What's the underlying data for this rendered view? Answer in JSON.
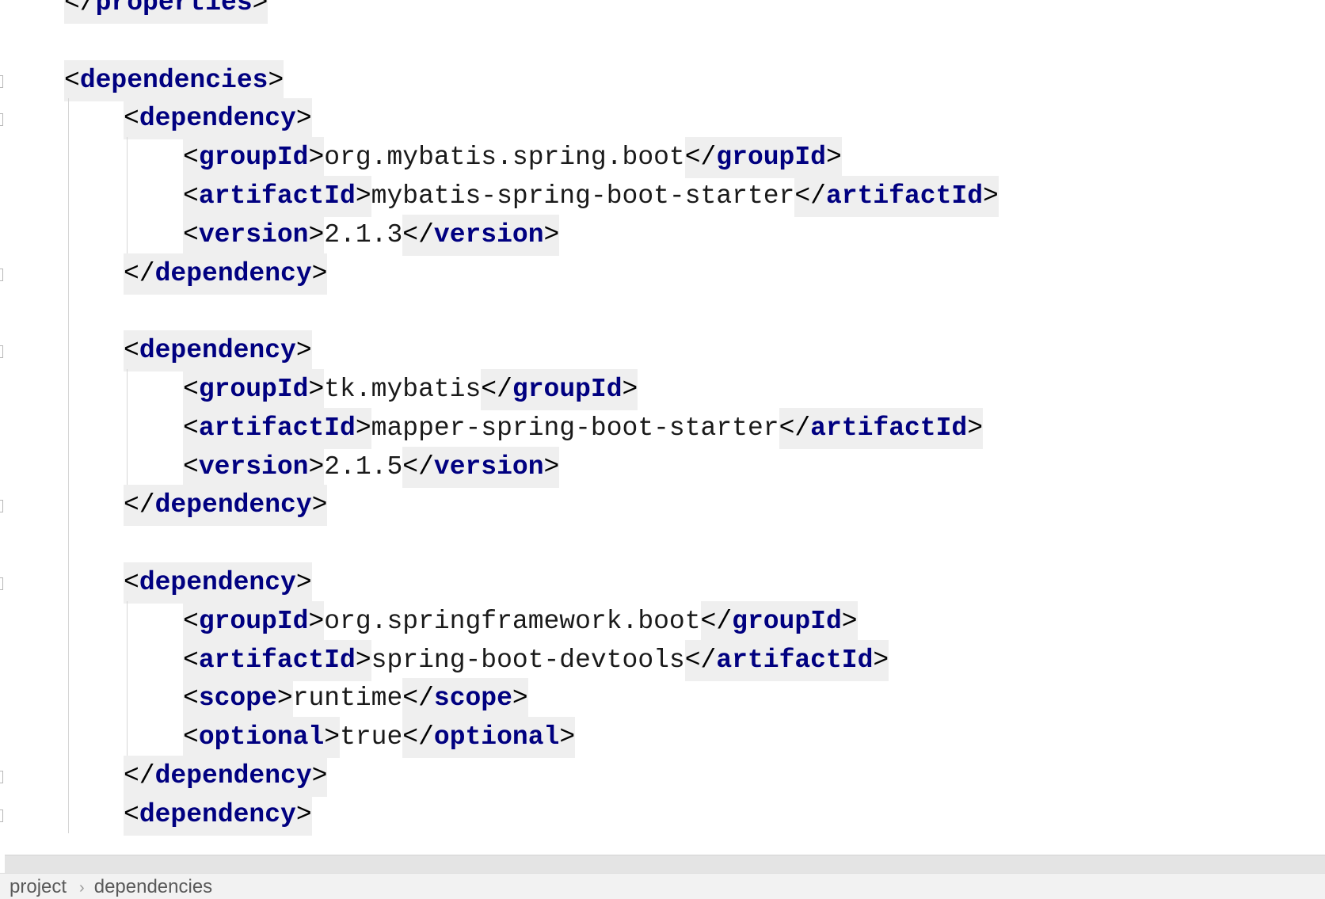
{
  "editor": {
    "lines": [
      {
        "indent": 0,
        "tokens": [
          {
            "t": "</"
          },
          {
            "tag": "properties"
          },
          {
            "t": ">"
          }
        ]
      },
      {
        "indent": 0,
        "tokens": []
      },
      {
        "indent": 0,
        "tokens": [
          {
            "t": "<"
          },
          {
            "tag": "dependencies"
          },
          {
            "t": ">"
          }
        ]
      },
      {
        "indent": 1,
        "tokens": [
          {
            "t": "<"
          },
          {
            "tag": "dependency"
          },
          {
            "t": ">"
          }
        ]
      },
      {
        "indent": 2,
        "tokens": [
          {
            "t": "<"
          },
          {
            "tag": "groupId"
          },
          {
            "t": ">"
          },
          {
            "text": "org.mybatis.spring.boot"
          },
          {
            "t": "</"
          },
          {
            "tag": "groupId"
          },
          {
            "t": ">"
          }
        ]
      },
      {
        "indent": 2,
        "tokens": [
          {
            "t": "<"
          },
          {
            "tag": "artifactId"
          },
          {
            "t": ">"
          },
          {
            "text": "mybatis-spring-boot-starter"
          },
          {
            "t": "</"
          },
          {
            "tag": "artifactId"
          },
          {
            "t": ">"
          }
        ]
      },
      {
        "indent": 2,
        "tokens": [
          {
            "t": "<"
          },
          {
            "tag": "version"
          },
          {
            "t": ">"
          },
          {
            "text": "2.1.3"
          },
          {
            "t": "</"
          },
          {
            "tag": "version"
          },
          {
            "t": ">"
          }
        ]
      },
      {
        "indent": 1,
        "tokens": [
          {
            "t": "</"
          },
          {
            "tag": "dependency"
          },
          {
            "t": ">"
          }
        ]
      },
      {
        "indent": 0,
        "tokens": []
      },
      {
        "indent": 1,
        "tokens": [
          {
            "t": "<"
          },
          {
            "tag": "dependency"
          },
          {
            "t": ">"
          }
        ]
      },
      {
        "indent": 2,
        "tokens": [
          {
            "t": "<"
          },
          {
            "tag": "groupId"
          },
          {
            "t": ">"
          },
          {
            "text": "tk.mybatis"
          },
          {
            "t": "</"
          },
          {
            "tag": "groupId"
          },
          {
            "t": ">"
          }
        ]
      },
      {
        "indent": 2,
        "tokens": [
          {
            "t": "<"
          },
          {
            "tag": "artifactId"
          },
          {
            "t": ">"
          },
          {
            "text": "mapper-spring-boot-starter"
          },
          {
            "t": "</"
          },
          {
            "tag": "artifactId"
          },
          {
            "t": ">"
          }
        ]
      },
      {
        "indent": 2,
        "tokens": [
          {
            "t": "<"
          },
          {
            "tag": "version"
          },
          {
            "t": ">"
          },
          {
            "text": "2.1.5"
          },
          {
            "t": "</"
          },
          {
            "tag": "version"
          },
          {
            "t": ">"
          }
        ]
      },
      {
        "indent": 1,
        "tokens": [
          {
            "t": "</"
          },
          {
            "tag": "dependency"
          },
          {
            "t": ">"
          }
        ]
      },
      {
        "indent": 0,
        "tokens": []
      },
      {
        "indent": 1,
        "tokens": [
          {
            "t": "<"
          },
          {
            "tag": "dependency"
          },
          {
            "t": ">"
          }
        ]
      },
      {
        "indent": 2,
        "tokens": [
          {
            "t": "<"
          },
          {
            "tag": "groupId"
          },
          {
            "t": ">"
          },
          {
            "text": "org.springframework.boot"
          },
          {
            "t": "</"
          },
          {
            "tag": "groupId"
          },
          {
            "t": ">"
          }
        ]
      },
      {
        "indent": 2,
        "tokens": [
          {
            "t": "<"
          },
          {
            "tag": "artifactId"
          },
          {
            "t": ">"
          },
          {
            "text": "spring-boot-devtools"
          },
          {
            "t": "</"
          },
          {
            "tag": "artifactId"
          },
          {
            "t": ">"
          }
        ]
      },
      {
        "indent": 2,
        "tokens": [
          {
            "t": "<"
          },
          {
            "tag": "scope"
          },
          {
            "t": ">"
          },
          {
            "text": "runtime"
          },
          {
            "t": "</"
          },
          {
            "tag": "scope"
          },
          {
            "t": ">"
          }
        ]
      },
      {
        "indent": 2,
        "tokens": [
          {
            "t": "<"
          },
          {
            "tag": "optional"
          },
          {
            "t": ">"
          },
          {
            "text": "true"
          },
          {
            "t": "</"
          },
          {
            "tag": "optional"
          },
          {
            "t": ">"
          }
        ]
      },
      {
        "indent": 1,
        "tokens": [
          {
            "t": "</"
          },
          {
            "tag": "dependency"
          },
          {
            "t": ">"
          }
        ]
      },
      {
        "indent": 1,
        "tokens": [
          {
            "t": "<"
          },
          {
            "tag": "dependency"
          },
          {
            "t": ">"
          }
        ]
      }
    ]
  },
  "breadcrumb": {
    "items": [
      "project",
      "dependencies"
    ],
    "separator": "›"
  },
  "colors": {
    "tag_name": "#000080",
    "tag_highlight": "#efefef",
    "text_value": "#1a1a1a",
    "breadcrumb_bg": "#f2f2f2"
  }
}
